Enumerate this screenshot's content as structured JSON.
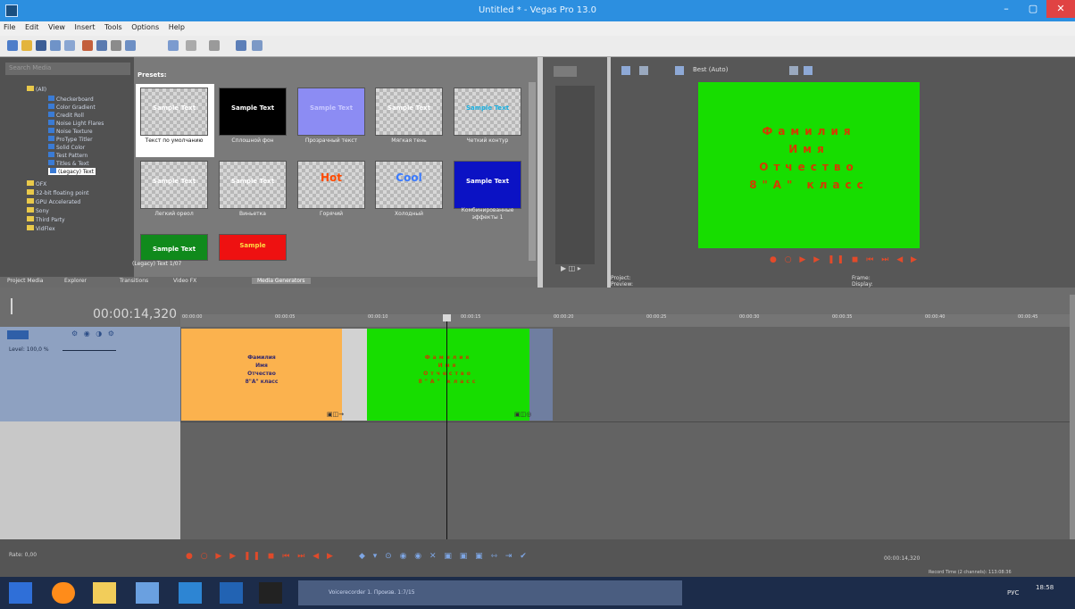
{
  "window": {
    "title": "Untitled * - Vegas Pro 13.0",
    "controls": [
      "–",
      "▢",
      "✕"
    ]
  },
  "menu": [
    "File",
    "Edit",
    "View",
    "Insert",
    "Tools",
    "Options",
    "Help"
  ],
  "explorer": {
    "search_placeholder": "Search Media",
    "tree": [
      {
        "label": "(All)",
        "kind": "folder"
      },
      {
        "label": "Checkerboard",
        "kind": "fx"
      },
      {
        "label": "Color Gradient",
        "kind": "fx"
      },
      {
        "label": "Credit Roll",
        "kind": "fx"
      },
      {
        "label": "Noise Light Flares",
        "kind": "fx"
      },
      {
        "label": "Noise Texture",
        "kind": "fx"
      },
      {
        "label": "ProType Titler",
        "kind": "fx"
      },
      {
        "label": "Solid Color",
        "kind": "fx"
      },
      {
        "label": "Test Pattern",
        "kind": "fx"
      },
      {
        "label": "Titles & Text",
        "kind": "fx"
      },
      {
        "label": "(Legacy) Text",
        "kind": "fx"
      },
      {
        "label": "OFX",
        "kind": "folder"
      },
      {
        "label": "32-bit floating point",
        "kind": "folder"
      },
      {
        "label": "GPU Accelerated",
        "kind": "folder"
      },
      {
        "label": "Sony",
        "kind": "folder"
      },
      {
        "label": "Third Party",
        "kind": "folder"
      },
      {
        "label": "VidFlex",
        "kind": "folder"
      }
    ]
  },
  "presets": {
    "header": "Presets:",
    "items": [
      {
        "label": "Текст по умолчанию",
        "thumb_text": "Sample Text",
        "style": "checker-white",
        "text_color": "#ffffff"
      },
      {
        "label": "Сплошной фон",
        "thumb_text": "Sample Text",
        "style": "black",
        "text_color": "#ffffff"
      },
      {
        "label": "Прозрачный текст",
        "thumb_text": "Sample Text",
        "style": "lavender",
        "text_color": "#c8c8ff"
      },
      {
        "label": "Мягкая тень",
        "thumb_text": "Sample Text",
        "style": "checker",
        "text_color": "#ffffff"
      },
      {
        "label": "Четкий контур",
        "thumb_text": "Sample Text",
        "style": "checker",
        "text_color": "#1ab0e0"
      },
      {
        "label": "Легкий ореол",
        "thumb_text": "Sample Text",
        "style": "checker",
        "text_color": "#ffffff"
      },
      {
        "label": "Виньетка",
        "thumb_text": "Sample Text",
        "style": "checker",
        "text_color": "#ffffff"
      },
      {
        "label": "Горячий",
        "thumb_text": "Hot",
        "style": "checker",
        "text_color": "#ff4a00"
      },
      {
        "label": "Холодный",
        "thumb_text": "Cool",
        "style": "checker",
        "text_color": "#3b7bff"
      },
      {
        "label": "Комбинированные эффекты 1",
        "thumb_text": "Sample Text",
        "style": "blue",
        "text_color": "#ffffff"
      },
      {
        "label": "(Legacy) Text 1/07",
        "thumb_text": "Sample Text",
        "style": "green",
        "text_color": "#ffffff"
      },
      {
        "label": "",
        "thumb_text": "Sample",
        "style": "red",
        "text_color": "#ffdd44"
      }
    ]
  },
  "tabs": [
    "Project Media",
    "Explorer",
    "Transitions",
    "Video FX",
    "Media Generators"
  ],
  "preview": {
    "toolbar_label": "Best (Auto)",
    "lines": [
      "Фамилия",
      "Имя",
      "Отчество",
      "8\"А\" класс"
    ],
    "info_left": [
      "Project:",
      "Preview:"
    ],
    "info_right": [
      "Frame:",
      "Display:"
    ]
  },
  "timeline": {
    "timecode": "00:00:14,320",
    "ticks": [
      "00:00:00",
      "00:00:05",
      "00:00:10",
      "00:00:15",
      "00:00:20",
      "00:00:25",
      "00:00:30",
      "00:00:35",
      "00:00:40",
      "00:00:45"
    ],
    "track_level": "Level: 100,0 %",
    "clip1_lines": [
      "Фамилия",
      "Имя",
      "Отчество",
      "8\"А\" класс"
    ],
    "clip2_lines": [
      "Фамилия",
      "Имя",
      "Отчество",
      "8\"А\" класс"
    ]
  },
  "status": {
    "rate": "Rate: 0,00",
    "time": "00:00:14,320",
    "record": "Record Time (2 channels): 113:08:36"
  },
  "taskbar": {
    "item": "Voicerecorder 1. Произв. 1:7/15",
    "lang": "РУС",
    "clock": "18:58"
  },
  "colors": {
    "accent": "#2c8fe0",
    "preview_bg": "#17dd00",
    "preview_text": "#d43a00",
    "clip1": "#fbb24e",
    "track_header": "#8ea1c1"
  }
}
